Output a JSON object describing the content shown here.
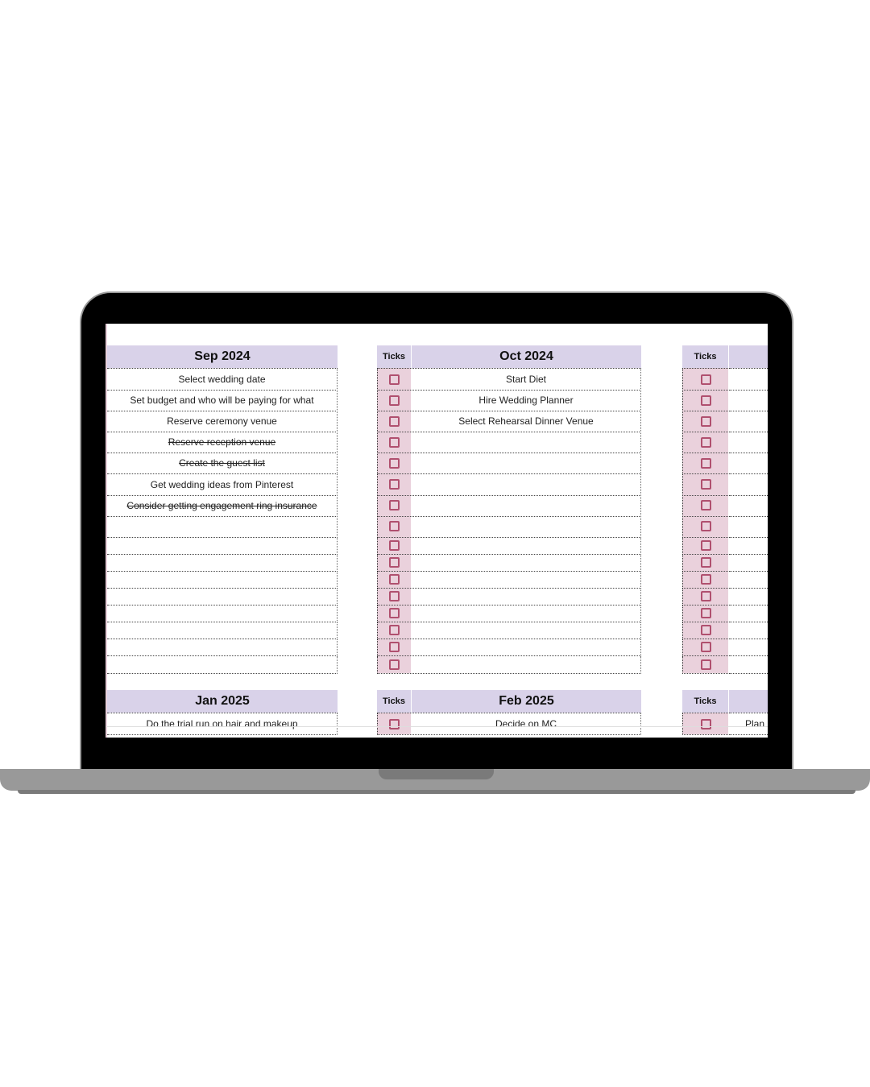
{
  "device": "laptop-mockup",
  "ticks_label": "Ticks",
  "colors": {
    "header_bg": "#d9d2e9",
    "ticks_bg": "#ead1dc",
    "checkbox": "#b0506f"
  },
  "top_section": {
    "months": [
      {
        "title": "Sep 2024",
        "tasks": [
          {
            "text": "Select wedding date",
            "done": false,
            "checked": false
          },
          {
            "text": "Set budget and who will be paying for what",
            "done": false,
            "checked": false
          },
          {
            "text": "Reserve ceremony venue",
            "done": false,
            "checked": false
          },
          {
            "text": "Reserve reception venue",
            "done": true,
            "checked": false
          },
          {
            "text": "Create the guest list",
            "done": true,
            "checked": false
          },
          {
            "text": "Get wedding ideas from Pinterest",
            "done": false,
            "checked": false
          },
          {
            "text": "Consider getting engagement ring insurance",
            "done": true,
            "checked": false
          },
          {
            "text": "",
            "done": false,
            "checked": false
          },
          {
            "text": "",
            "done": false,
            "checked": false
          },
          {
            "text": "",
            "done": false,
            "checked": false
          },
          {
            "text": "",
            "done": false,
            "checked": false
          },
          {
            "text": "",
            "done": false,
            "checked": false
          },
          {
            "text": "",
            "done": false,
            "checked": false
          },
          {
            "text": "",
            "done": false,
            "checked": false
          },
          {
            "text": "",
            "done": false,
            "checked": false
          },
          {
            "text": "",
            "done": false,
            "checked": false
          }
        ]
      },
      {
        "title": "Oct 2024",
        "tasks": [
          {
            "text": "Start Diet",
            "done": false,
            "checked": false
          },
          {
            "text": "Hire Wedding Planner",
            "done": false,
            "checked": false
          },
          {
            "text": "Select Rehearsal Dinner Venue",
            "done": false,
            "checked": false
          },
          {
            "text": "",
            "done": false,
            "checked": false
          },
          {
            "text": "",
            "done": false,
            "checked": false
          },
          {
            "text": "",
            "done": false,
            "checked": false
          },
          {
            "text": "",
            "done": false,
            "checked": false
          },
          {
            "text": "",
            "done": false,
            "checked": false
          },
          {
            "text": "",
            "done": false,
            "checked": false
          },
          {
            "text": "",
            "done": false,
            "checked": false
          },
          {
            "text": "",
            "done": false,
            "checked": false
          },
          {
            "text": "",
            "done": false,
            "checked": false
          },
          {
            "text": "",
            "done": false,
            "checked": false
          },
          {
            "text": "",
            "done": false,
            "checked": false
          },
          {
            "text": "",
            "done": false,
            "checked": false
          },
          {
            "text": "",
            "done": false,
            "checked": false
          }
        ]
      },
      {
        "title": "",
        "tasks": []
      }
    ]
  },
  "bottom_section": {
    "months": [
      {
        "title": "Jan 2025",
        "tasks": [
          {
            "text": "Do the trial run on hair and makeup",
            "done": false,
            "checked": false
          }
        ]
      },
      {
        "title": "Feb 2025",
        "tasks": [
          {
            "text": "Decide on MC",
            "done": false,
            "checked": false
          }
        ]
      },
      {
        "title": "",
        "tasks": [
          {
            "text": "Plan",
            "done": false,
            "checked": false
          }
        ]
      }
    ]
  }
}
